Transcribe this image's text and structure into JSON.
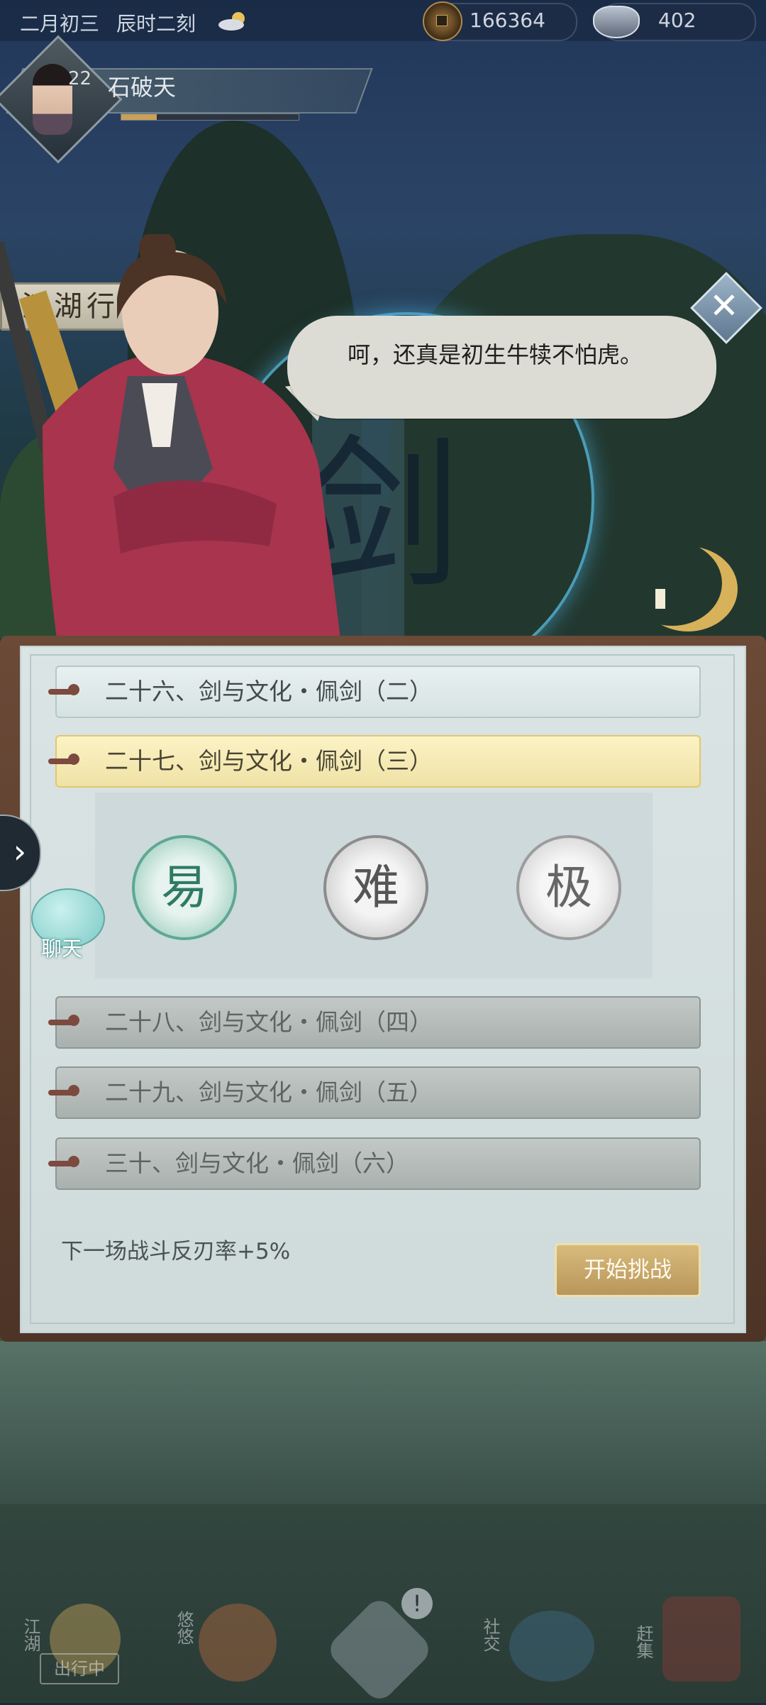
{
  "topbar": {
    "date": "二月初三",
    "time": "辰时二刻",
    "weather_icon": "sun-cloud-icon",
    "copper_coins": "166364",
    "silver_ingots": "402"
  },
  "player": {
    "level": "22",
    "name": "石破天",
    "exp_fraction": 0.2
  },
  "location_banner": "江湖行",
  "dialog": {
    "text": "呵，还真是初生牛犊不怕虎。",
    "close_icon": "close-icon"
  },
  "panel": {
    "chapters": [
      {
        "label": "二十六、剑与文化・佩剑（二）",
        "state": "normal"
      },
      {
        "label": "二十七、剑与文化・佩剑（三）",
        "state": "active"
      },
      {
        "label": "二十八、剑与文化・佩剑（四）",
        "state": "locked"
      },
      {
        "label": "二十九、剑与文化・佩剑（五）",
        "state": "locked"
      },
      {
        "label": "三十、剑与文化・佩剑（六）",
        "state": "locked"
      }
    ],
    "difficulties": {
      "easy": "易",
      "hard": "难",
      "extreme": "极"
    },
    "buff_text": "下一场战斗反刃率+5%",
    "start_button": "开始挑战"
  },
  "side": {
    "chat_label": "聊天"
  },
  "bottom_nav": {
    "items": [
      {
        "label": "江湖",
        "icon": "travel-icon",
        "tag": "出行中"
      },
      {
        "label": "悠悠",
        "icon": "bird-icon"
      },
      {
        "label": "",
        "icon": "compass-star-icon",
        "badge": "!"
      },
      {
        "label": "社交",
        "icon": "social-icon"
      },
      {
        "label": "赶集",
        "icon": "market-basket-icon"
      }
    ]
  },
  "colors": {
    "active_row": "#f0e2a6",
    "start_button": "#c8a868",
    "panel_frame": "#5a3c2c"
  }
}
